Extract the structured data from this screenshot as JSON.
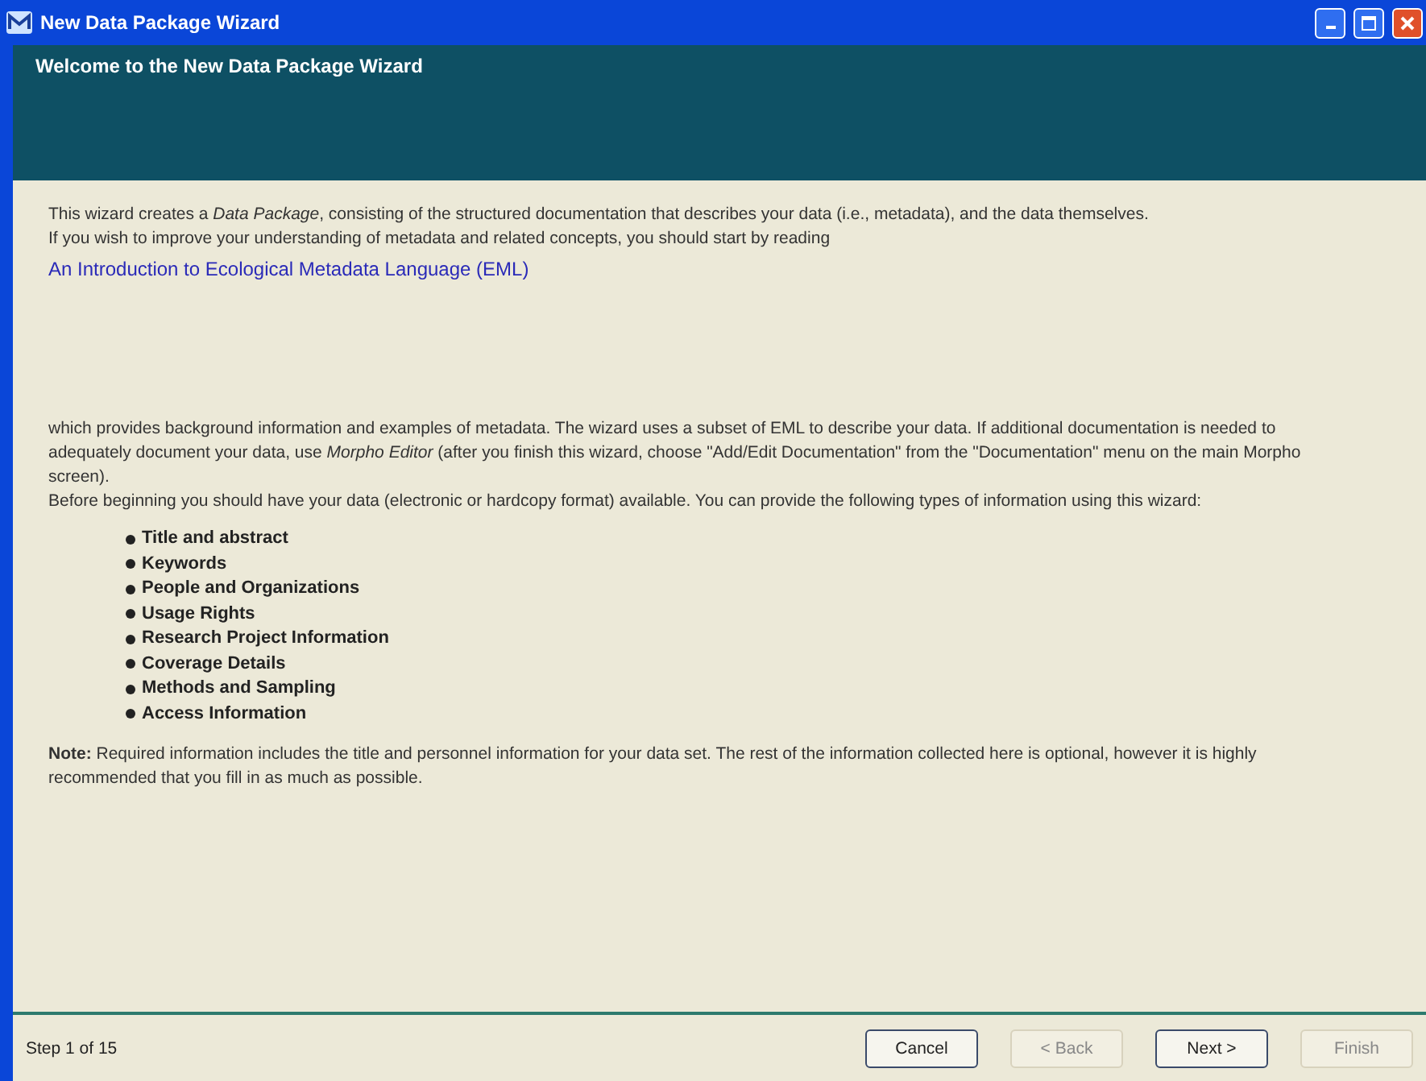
{
  "window": {
    "title": "New Data Package Wizard"
  },
  "header": {
    "title": "Welcome to the New Data Package Wizard"
  },
  "intro": [
    "This wizard creates a *Data Package*, consisting of the structured documentation that describes your data (i.e., metadata), and the data themselves.",
    "If you wish to improve your understanding of metadata and related concepts, you should start by reading"
  ],
  "link": "An Introduction to Ecological Metadata Language (EML)",
  "body": [
    "which provides background information and examples of metadata. The wizard uses a subset of EML to describe your data. If additional documentation is needed to adequately document your data, use *Morpho Editor* (after you finish this wizard, choose \"Add/Edit Documentation\" from the \"Documentation\" menu on the main Morpho screen).",
    "Before beginning you should have your data (electronic or hardcopy format) available. You can provide the following types of information using this wizard:"
  ],
  "items": [
    "Title and abstract",
    "Keywords",
    "People and Organizations",
    "Usage Rights",
    "Research Project Information",
    "Coverage Details",
    "Methods and Sampling",
    "Access Information"
  ],
  "note": "**Note:** Required information includes the title and personnel information for your data set. The rest of the information collected here is optional, however it is highly recommended that you fill in as much as possible.",
  "status": "Step 1 of 15",
  "buttons": [
    {
      "label": "Cancel",
      "disabled": false
    },
    {
      "label": "< Back",
      "disabled": true
    },
    {
      "label": "Next >",
      "disabled": false
    },
    {
      "label": "Finish",
      "disabled": true
    }
  ]
}
